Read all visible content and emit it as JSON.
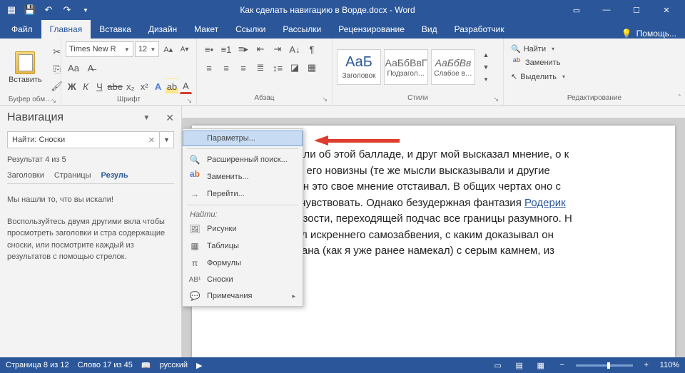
{
  "titlebar": {
    "doc_title": "Как сделать навигацию в Ворде.docx - Word"
  },
  "tabs": {
    "file": "Файл",
    "home": "Главная",
    "insert": "Вставка",
    "design": "Дизайн",
    "layout": "Макет",
    "references": "Ссылки",
    "mailings": "Рассылки",
    "review": "Рецензирование",
    "view": "Вид",
    "developer": "Разработчик",
    "help": "Помощь..."
  },
  "ribbon": {
    "clipboard": {
      "paste": "Вставить",
      "group": "Буфер обм…"
    },
    "font": {
      "family": "Times New R",
      "size": "12",
      "group": "Шрифт"
    },
    "paragraph": {
      "group": "Абзац"
    },
    "styles": {
      "s1_preview": "АаБ",
      "s1_name": "Заголовок",
      "s2_preview": "АаБбВвГ",
      "s2_name": "Подзагол…",
      "s3_preview": "АаБбВв",
      "s3_name": "Слабое в…",
      "group": "Стили"
    },
    "editing": {
      "find": "Найти",
      "replace": "Заменить",
      "select": "Выделить",
      "group": "Редактирование"
    }
  },
  "nav": {
    "title": "Навигация",
    "search_value": "Найти: Сноски",
    "result": "Результат 4 из 5",
    "t_headings": "Заголовки",
    "t_pages": "Страницы",
    "t_results": "Резуль",
    "found": "Мы нашли то, что вы искали!",
    "hint": "Воспользуйтесь двумя другими вкла чтобы просмотреть заголовки и стра содержащие сноски, или посмотрите каждый из результатов с помощью стрелок."
  },
  "dropdown": {
    "options": "Параметры...",
    "adv_find": "Расширенный поиск...",
    "replace": "Заменить...",
    "goto": "Перейти...",
    "find_label": "Найти:",
    "graphics": "Рисунки",
    "tables": "Таблицы",
    "formulas": "Формулы",
    "footnotes": "Сноски",
    "comments": "Примечания"
  },
  "document": {
    "p1a": "потом мы беседовали об этой балладе, и друг мой высказал мнение, о к",
    "p1b": "аю не столько ради его новизны (те же мысли высказывали и другие",
    "p1c": "упорства, с каким он это свое мнение отстаивал. В общих чертах оно с",
    "p1d": "астения способны чувствовать. Однако безудержная фантазия ",
    "p1d_link": "Родерик",
    "p1e": "сль до крайней дерзости, переходящей подчас все границы разумного. Н",
    "p1f": "полне передать пыл искреннего самозабвения, с каким доказывал он",
    "p1g": "вера его была связана (как я уже ранее намекал) с серым камнем, из "
  },
  "statusbar": {
    "page": "Страница 8 из 12",
    "words": "Слово 17 из 45",
    "lang": "русский",
    "zoom": "110%"
  }
}
